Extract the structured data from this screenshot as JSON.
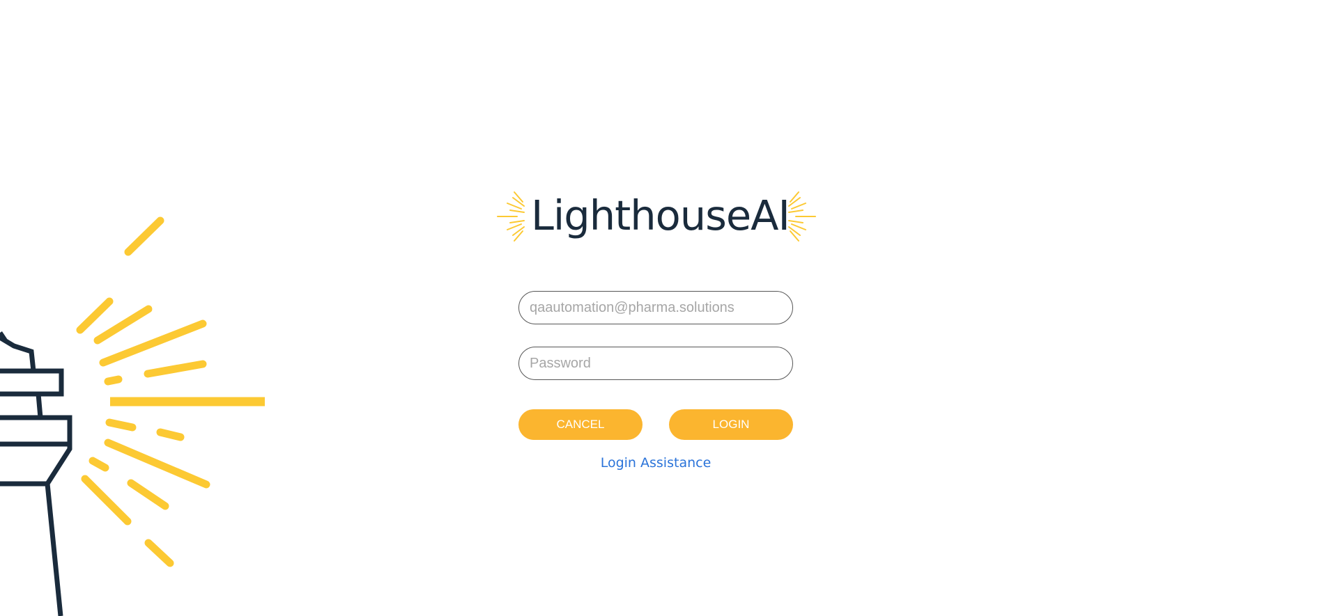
{
  "brand": {
    "name": "LighthouseAI",
    "text_color": "#1a2b3c",
    "accent_color": "#fbc02d"
  },
  "form": {
    "email": {
      "value": "",
      "placeholder": "qaautomation@pharma.solutions"
    },
    "password": {
      "value": "",
      "placeholder": "Password"
    },
    "cancel_label": "CANCEL",
    "login_label": "LOGIN",
    "button_color": "#fbb52f",
    "assistance_link": "Login Assistance",
    "link_color": "#2a73d9"
  },
  "illustration": {
    "icon": "lighthouse-icon"
  }
}
